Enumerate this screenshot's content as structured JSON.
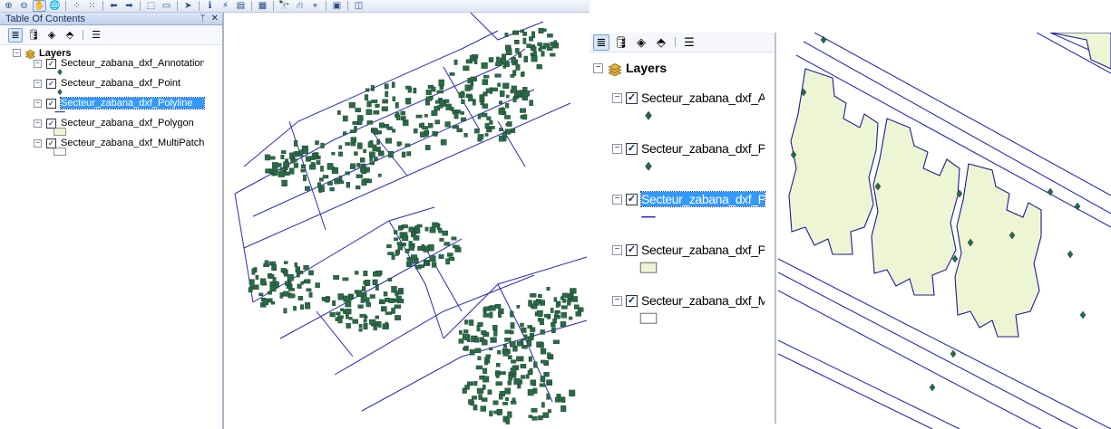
{
  "toolbar": {
    "buttons": [
      {
        "name": "zoom-in-icon",
        "glyph": "⊕"
      },
      {
        "name": "zoom-out-icon",
        "glyph": "⊖"
      },
      {
        "name": "pan-icon",
        "glyph": "✋"
      },
      {
        "name": "full-extent-icon",
        "glyph": "🌐"
      },
      {
        "name": "fixed-zoom-in-icon",
        "glyph": "⁘"
      },
      {
        "name": "fixed-zoom-out-icon",
        "glyph": "⁙"
      },
      {
        "name": "back-extent-icon",
        "glyph": "⬅"
      },
      {
        "name": "forward-extent-icon",
        "glyph": "➡"
      },
      {
        "name": "select-features-icon",
        "glyph": "⬚"
      },
      {
        "name": "clear-selection-icon",
        "glyph": "▭"
      },
      {
        "name": "select-elements-icon",
        "glyph": "➤"
      },
      {
        "name": "identify-icon",
        "glyph": "ℹ"
      },
      {
        "name": "hyperlink-icon",
        "glyph": "⚡"
      },
      {
        "name": "html-popup-icon",
        "glyph": "▤"
      },
      {
        "name": "measure-icon",
        "glyph": "▦"
      },
      {
        "name": "find-icon",
        "glyph": "🔭"
      },
      {
        "name": "find-route-icon",
        "glyph": "⛙"
      },
      {
        "name": "go-to-xy-icon",
        "glyph": "⌖"
      },
      {
        "name": "time-slider-icon",
        "glyph": "▣"
      },
      {
        "name": "create-viewer-icon",
        "glyph": "◫"
      }
    ]
  },
  "toc": {
    "title": "Table Of Contents",
    "pin_glyph": "ᛘ",
    "close_glyph": "✕",
    "tools": [
      {
        "name": "list-by-drawing-order-icon",
        "glyph": "≣"
      },
      {
        "name": "list-by-source-icon",
        "glyph": "🛢"
      },
      {
        "name": "list-by-visibility-icon",
        "glyph": "◈"
      },
      {
        "name": "list-by-selection-icon",
        "glyph": "⬘"
      },
      {
        "name": "options-icon",
        "glyph": "☰"
      }
    ]
  },
  "layers": {
    "group_label": "Layers",
    "items": [
      {
        "label": "Secteur_zabana_dxf_Annotation",
        "checked": true,
        "selected": false,
        "symbol": "point"
      },
      {
        "label": "Secteur_zabana_dxf_Point",
        "checked": true,
        "selected": false,
        "symbol": "point"
      },
      {
        "label": "Secteur_zabana_dxf_Polyline",
        "checked": true,
        "selected": true,
        "symbol": "line"
      },
      {
        "label": "Secteur_zabana_dxf_Polygon",
        "checked": true,
        "selected": false,
        "symbol": "polygon-filled"
      },
      {
        "label": "Secteur_zabana_dxf_MultiPatch",
        "checked": true,
        "selected": false,
        "symbol": "polygon-empty"
      }
    ]
  },
  "colors": {
    "point": "#2a6b47",
    "point_stroke": "#1b3b2b",
    "line": "#2b2bb0",
    "polygon_fill": "#eef5d5",
    "polygon_stroke": "#1d1d8c",
    "selection": "#3399ff",
    "layers_icon": "#e2b23a"
  }
}
